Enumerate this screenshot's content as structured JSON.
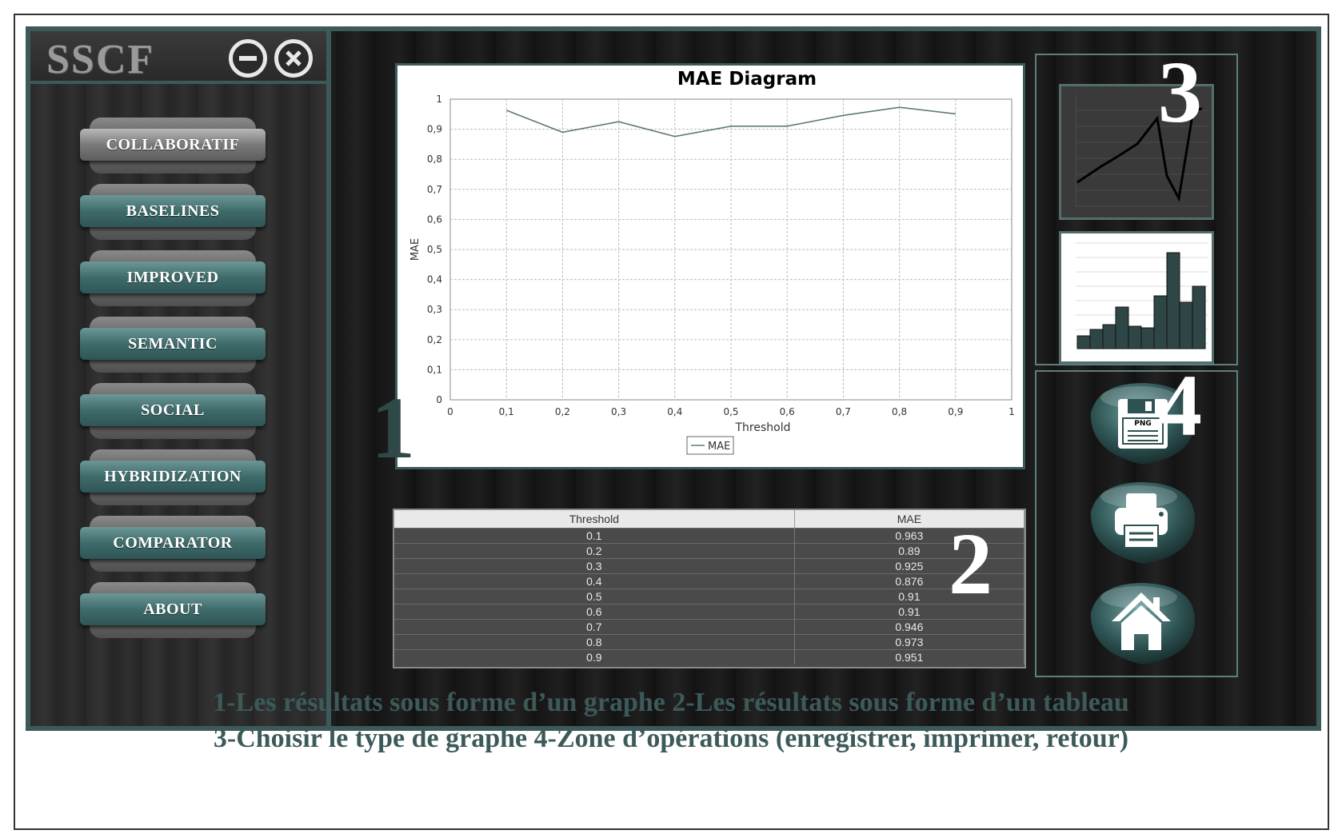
{
  "app": {
    "logo": "SSCF"
  },
  "sidebar": {
    "items": [
      {
        "label": "COLLABORATIF"
      },
      {
        "label": "BASELINES"
      },
      {
        "label": "IMPROVED"
      },
      {
        "label": "SEMANTIC"
      },
      {
        "label": "SOCIAL"
      },
      {
        "label": "HYBRIDIZATION"
      },
      {
        "label": "COMPARATOR"
      },
      {
        "label": "ABOUT"
      }
    ]
  },
  "chart_data": {
    "type": "line",
    "title": "MAE Diagram",
    "xlabel": "Threshold",
    "ylabel": "MAE",
    "xlim": [
      0,
      1
    ],
    "ylim": [
      0,
      1
    ],
    "xticks": [
      "0",
      "0,1",
      "0,2",
      "0,3",
      "0,4",
      "0,5",
      "0,6",
      "0,7",
      "0,8",
      "0,9",
      "1"
    ],
    "yticks": [
      "0",
      "0,1",
      "0,2",
      "0,3",
      "0,4",
      "0,5",
      "0,6",
      "0,7",
      "0,8",
      "0,9",
      "1"
    ],
    "grid": true,
    "legend": "bottom-center",
    "series": [
      {
        "name": "MAE",
        "color": "#5f7a78",
        "x": [
          0.1,
          0.2,
          0.3,
          0.4,
          0.5,
          0.6,
          0.7,
          0.8,
          0.9
        ],
        "y": [
          0.963,
          0.89,
          0.925,
          0.876,
          0.91,
          0.91,
          0.946,
          0.973,
          0.951
        ]
      }
    ]
  },
  "table": {
    "headers": [
      "Threshold",
      "MAE"
    ],
    "rows": [
      [
        "0.1",
        "0.963"
      ],
      [
        "0.2",
        "0.89"
      ],
      [
        "0.3",
        "0.925"
      ],
      [
        "0.4",
        "0.876"
      ],
      [
        "0.5",
        "0.91"
      ],
      [
        "0.6",
        "0.91"
      ],
      [
        "0.7",
        "0.946"
      ],
      [
        "0.8",
        "0.973"
      ],
      [
        "0.9",
        "0.951"
      ]
    ]
  },
  "markers": {
    "one": "1",
    "two": "2",
    "three": "3",
    "four": "4"
  },
  "operations": {
    "save_icon_text": "PNG"
  },
  "caption": {
    "line1": "1-Les résultats sous forme d’un graphe 2-Les résultats sous forme d’un tableau",
    "line2": "3-Choisir le type de graphe 4-Zone d’opérations (enregistrer, imprimer, retour)"
  },
  "colors": {
    "accent": "#3d5a5a",
    "button_teal": "#3f6b6b",
    "line": "#5f7a78"
  }
}
